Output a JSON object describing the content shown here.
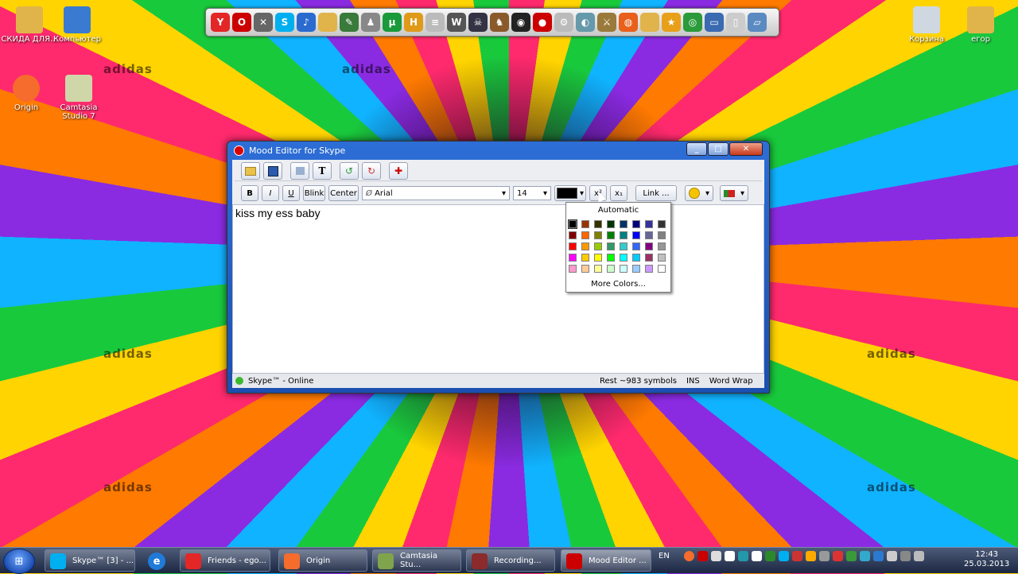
{
  "desktop": {
    "icons": [
      {
        "label": "СКИДА ДЛЯ..."
      },
      {
        "label": "Компьютер"
      },
      {
        "label": "Origin"
      },
      {
        "label": "Camtasia Studio 7"
      },
      {
        "label": "Корзина"
      },
      {
        "label": "егор"
      }
    ],
    "watermark": "adidas"
  },
  "window": {
    "title": "Mood Editor for Skype",
    "controls": {
      "minimize": "_",
      "maximize": "□",
      "close": "✕"
    },
    "toolbar1": [
      "open-icon",
      "save-icon",
      "clear-icon",
      "text-icon",
      "undo-icon",
      "redo-icon",
      "plugin-icon"
    ],
    "toolbar1_text_glyph": "T",
    "format": {
      "bold": "B",
      "italic": "I",
      "underline": "U",
      "blink": "Blink",
      "center": "Center",
      "font_glyph": "Ø",
      "font": "Arial",
      "size": "14",
      "superscript": "x²",
      "subscript": "x₁",
      "link": "Link ...",
      "dropdown_arrow": "▾"
    },
    "editor_text": "kiss my ess baby",
    "status": {
      "skype": "Skype™ - Online",
      "rest": "Rest ~983 symbols",
      "ins": "INS",
      "wrap": "Word Wrap"
    }
  },
  "color_popup": {
    "automatic": "Automatic",
    "more_colors": "More Colors...",
    "colors": [
      "#000000",
      "#993300",
      "#333300",
      "#003300",
      "#003366",
      "#000080",
      "#333399",
      "#333333",
      "#800000",
      "#ff6600",
      "#808000",
      "#008000",
      "#008080",
      "#0000ff",
      "#666699",
      "#808080",
      "#ff0000",
      "#ff9900",
      "#99cc00",
      "#339966",
      "#33cccc",
      "#3366ff",
      "#800080",
      "#969696",
      "#ff00ff",
      "#ffcc00",
      "#ffff00",
      "#00ff00",
      "#00ffff",
      "#00ccff",
      "#993366",
      "#c0c0c0",
      "#ff99cc",
      "#ffcc99",
      "#ffff99",
      "#ccffcc",
      "#ccffff",
      "#99ccff",
      "#cc99ff",
      "#ffffff"
    ]
  },
  "taskbar": {
    "start_glyph": "⊞",
    "buttons": [
      {
        "label": "Skype™ [3] - ...",
        "color": "#00aff0"
      },
      {
        "label": "Friends - ego...",
        "color": "#e32626"
      },
      {
        "label": "Origin",
        "color": "#f56c2d"
      },
      {
        "label": "Camtasia Stu...",
        "color": "#7fa44b"
      },
      {
        "label": "Recording...",
        "color": "#8b2b2b"
      },
      {
        "label": "Mood Editor ...",
        "color": "#cc0000"
      }
    ],
    "lang": "EN",
    "time": "12:43",
    "date": "25.03.2013"
  }
}
